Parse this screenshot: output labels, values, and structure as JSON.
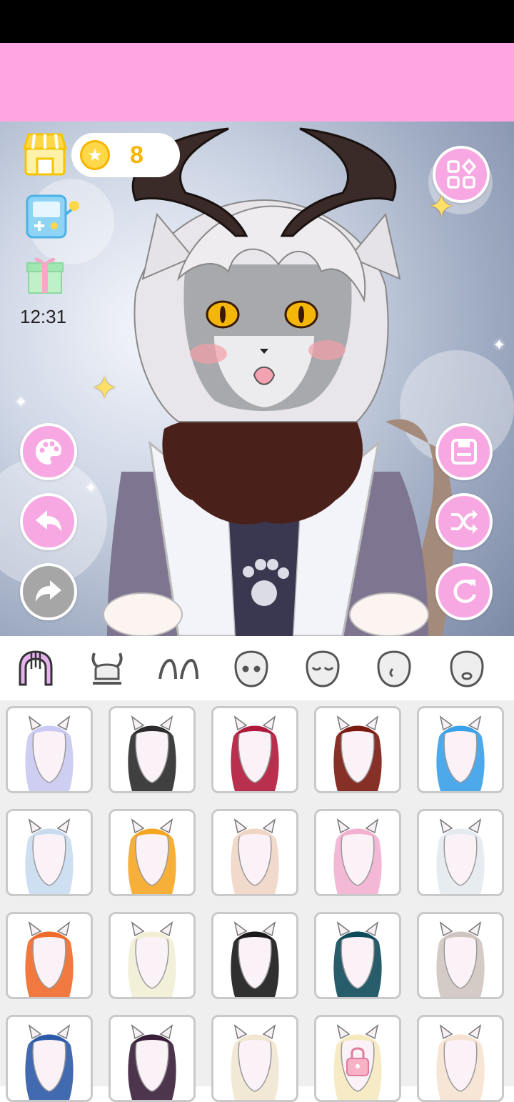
{
  "header": {
    "coins": "8",
    "time": "12:31"
  },
  "colors": {
    "banner": "#ffa5e2",
    "accent_button": "#f7a8e2",
    "disabled_button": "#a6a6a6",
    "coin": "#f7b500"
  },
  "left_toolbar": {
    "icons": [
      "shop-icon",
      "game-icon",
      "gift-icon"
    ]
  },
  "side_buttons": {
    "left": [
      "palette-icon",
      "undo-icon",
      "redo-icon"
    ],
    "right": [
      "categories-icon",
      "save-icon",
      "shuffle-icon",
      "reset-icon"
    ]
  },
  "category_tabs": [
    {
      "icon": "hair-icon",
      "selected": true
    },
    {
      "icon": "horns-icon",
      "selected": false
    },
    {
      "icon": "ears-icon",
      "selected": false
    },
    {
      "icon": "eyes-icon",
      "selected": false
    },
    {
      "icon": "closed-eyes-icon",
      "selected": false
    },
    {
      "icon": "face-side-icon",
      "selected": false
    },
    {
      "icon": "mouth-icon",
      "selected": false
    }
  ],
  "hair_options": [
    {
      "color": "#c9c9f2",
      "locked": false
    },
    {
      "color": "#2b2b2b",
      "locked": false
    },
    {
      "color": "#b01a3a",
      "locked": false
    },
    {
      "color": "#7a1a10",
      "locked": false
    },
    {
      "color": "#3aa0e8",
      "locked": false
    },
    {
      "color": "#c9dcef",
      "locked": false
    },
    {
      "color": "#f5a623",
      "locked": false
    },
    {
      "color": "#f0d5c5",
      "locked": false
    },
    {
      "color": "#f2b0d0",
      "locked": false
    },
    {
      "color": "#e4eaf0",
      "locked": false
    },
    {
      "color": "#f06a2a",
      "locked": false
    },
    {
      "color": "#f2eed6",
      "locked": false
    },
    {
      "color": "#1a1a1a",
      "locked": false
    },
    {
      "color": "#0f4a5a",
      "locked": false
    },
    {
      "color": "#cfc5c0",
      "locked": false
    },
    {
      "color": "#2d5aa8",
      "locked": false
    },
    {
      "color": "#3a1f3a",
      "locked": false
    },
    {
      "color": "#f1e6d2",
      "locked": false
    },
    {
      "color": "#f6e9bf",
      "locked": true
    },
    {
      "color": "#f6e2d2",
      "locked": false
    }
  ]
}
